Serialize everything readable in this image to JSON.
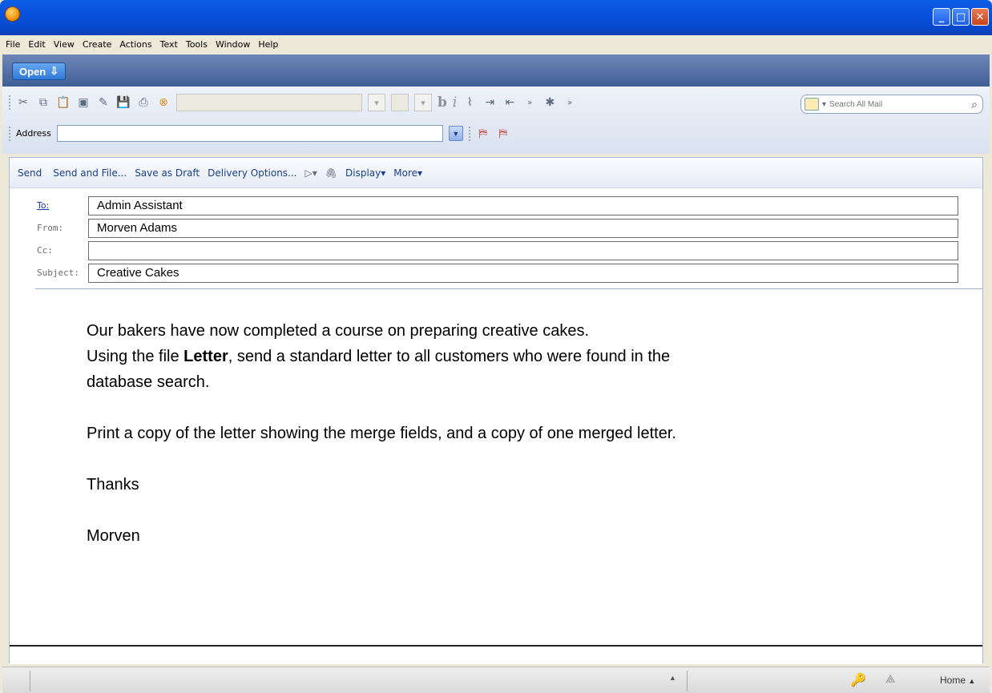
{
  "menu": [
    "File",
    "Edit",
    "View",
    "Create",
    "Actions",
    "Text",
    "Tools",
    "Window",
    "Help"
  ],
  "open_button": {
    "label": "Open",
    "icon": "download-arrow-icon"
  },
  "search": {
    "placeholder": "Search All Mail"
  },
  "address": {
    "label": "Address",
    "value": ""
  },
  "actions": {
    "send": "Send",
    "send_and_file": "Send and File...",
    "save_as_draft": "Save as Draft",
    "delivery_options": "Delivery Options...",
    "display": "Display",
    "more": "More"
  },
  "header": {
    "to_label": "To:",
    "to_value": "Admin Assistant",
    "from_label": "From:",
    "from_value": "Morven Adams",
    "cc_label": "Cc:",
    "cc_value": "",
    "subject_label": "Subject:",
    "subject_value": "Creative Cakes"
  },
  "body": {
    "line1": "Our bakers have now completed a course on preparing creative cakes.",
    "line2_prefix": "Using the file ",
    "line2_bold": "Letter",
    "line2_suffix": ", send a standard letter to all customers who were found in the",
    "line3": "database search.",
    "line4": "Print a copy of the letter showing the merge fields, and a copy of one merged letter.",
    "line5": "Thanks",
    "line6": "Morven"
  },
  "status": {
    "home_label": "Home"
  },
  "colors": {
    "title_blue": "#0a54df",
    "link_blue": "#1538b6"
  }
}
